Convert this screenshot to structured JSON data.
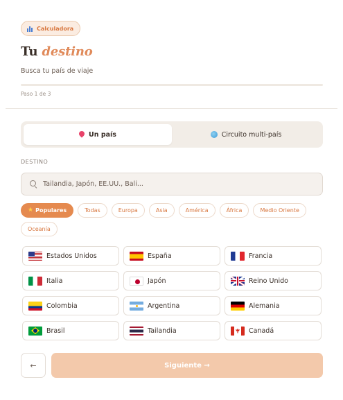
{
  "badge": {
    "label": "Calculadora",
    "icon": "bar-chart-icon"
  },
  "header": {
    "title_plain": "Tu",
    "title_accent": "destino",
    "subtitle": "Busca tu país de viaje"
  },
  "progress": {
    "step_label": "Paso 1 de 3",
    "current_step": 1,
    "total_steps": 3
  },
  "mode_tabs": [
    {
      "label": "Un país",
      "icon": "pin-icon",
      "active": true
    },
    {
      "label": "Circuito multi-país",
      "icon": "globe-icon",
      "active": false
    }
  ],
  "destination": {
    "label": "DESTINO",
    "placeholder": "Tailandia, Japón, EE.UU., Bali..."
  },
  "filters": [
    {
      "label": "Populares",
      "active": true,
      "icon": "star-icon"
    },
    {
      "label": "Todas",
      "active": false
    },
    {
      "label": "Europa",
      "active": false
    },
    {
      "label": "Asia",
      "active": false
    },
    {
      "label": "América",
      "active": false
    },
    {
      "label": "África",
      "active": false
    },
    {
      "label": "Medio Oriente",
      "active": false
    },
    {
      "label": "Oceanía",
      "active": false
    }
  ],
  "countries": [
    {
      "name": "Estados Unidos",
      "flag": "us-flag-icon"
    },
    {
      "name": "España",
      "flag": "es-flag-icon"
    },
    {
      "name": "Francia",
      "flag": "fr-flag-icon"
    },
    {
      "name": "Italia",
      "flag": "it-flag-icon"
    },
    {
      "name": "Japón",
      "flag": "jp-flag-icon"
    },
    {
      "name": "Reino Unido",
      "flag": "gb-flag-icon"
    },
    {
      "name": "Colombia",
      "flag": "co-flag-icon"
    },
    {
      "name": "Argentina",
      "flag": "ar-flag-icon"
    },
    {
      "name": "Alemania",
      "flag": "de-flag-icon"
    },
    {
      "name": "Brasil",
      "flag": "br-flag-icon"
    },
    {
      "name": "Tailandia",
      "flag": "th-flag-icon"
    },
    {
      "name": "Canadá",
      "flag": "ca-flag-icon"
    }
  ],
  "actions": {
    "back_label": "←",
    "next_label": "Siguiente →"
  },
  "colors": {
    "accent": "#e58a4f",
    "accent_soft": "#f3c9ab",
    "text": "#3a2f28",
    "muted": "#6b5d53"
  }
}
